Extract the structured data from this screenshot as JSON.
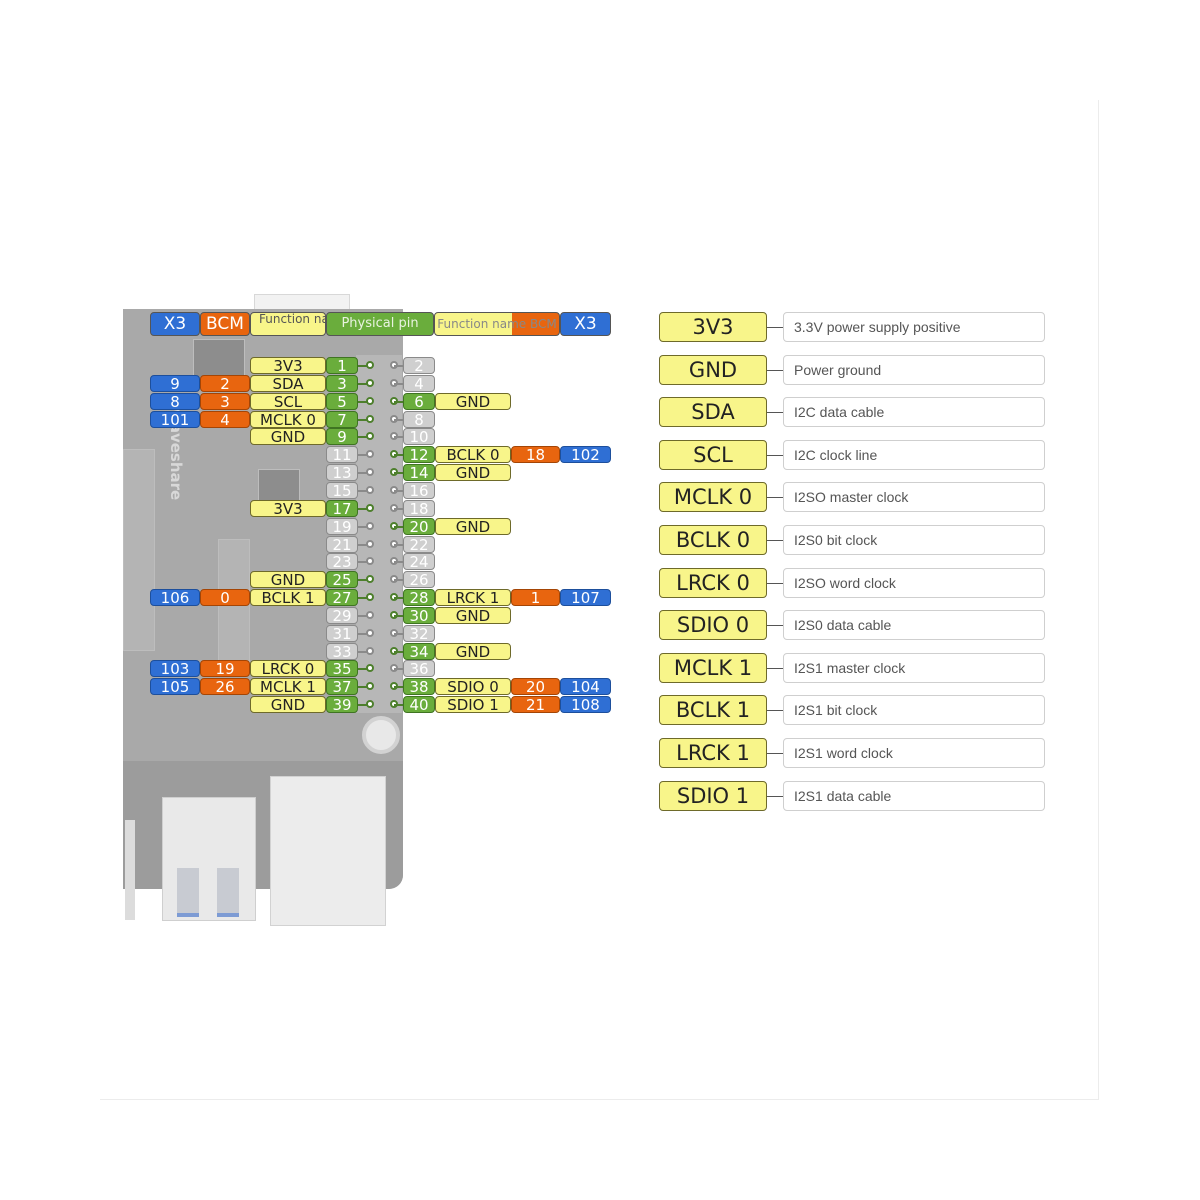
{
  "header": {
    "left": [
      "X3",
      "BCM",
      "Function name",
      "Physical pin"
    ],
    "right": [
      "Function name BCM",
      "X3"
    ]
  },
  "board": {
    "brand_text": "waveshare"
  },
  "colors": {
    "x3": "#2f6fd4",
    "bcm": "#e8650f",
    "function": "#f8f58a",
    "active_pin": "#6aad3c",
    "inactive_pin": "#cfcfcf"
  },
  "rows": [
    {
      "left": {
        "pin": "1",
        "fn": "3V3",
        "bcm": "",
        "x3": "",
        "active": true
      },
      "right": {
        "pin": "2",
        "fn": "",
        "bcm": "",
        "x3": "",
        "active": false
      }
    },
    {
      "left": {
        "pin": "3",
        "fn": "SDA",
        "bcm": "2",
        "x3": "9",
        "active": true
      },
      "right": {
        "pin": "4",
        "fn": "",
        "bcm": "",
        "x3": "",
        "active": false
      }
    },
    {
      "left": {
        "pin": "5",
        "fn": "SCL",
        "bcm": "3",
        "x3": "8",
        "active": true
      },
      "right": {
        "pin": "6",
        "fn": "GND",
        "bcm": "",
        "x3": "",
        "active": true
      }
    },
    {
      "left": {
        "pin": "7",
        "fn": "MCLK 0",
        "bcm": "4",
        "x3": "101",
        "active": true
      },
      "right": {
        "pin": "8",
        "fn": "",
        "bcm": "",
        "x3": "",
        "active": false
      }
    },
    {
      "left": {
        "pin": "9",
        "fn": "GND",
        "bcm": "",
        "x3": "",
        "active": true
      },
      "right": {
        "pin": "10",
        "fn": "",
        "bcm": "",
        "x3": "",
        "active": false
      }
    },
    {
      "left": {
        "pin": "11",
        "fn": "",
        "bcm": "",
        "x3": "",
        "active": false
      },
      "right": {
        "pin": "12",
        "fn": "BCLK 0",
        "bcm": "18",
        "x3": "102",
        "active": true
      }
    },
    {
      "left": {
        "pin": "13",
        "fn": "",
        "bcm": "",
        "x3": "",
        "active": false
      },
      "right": {
        "pin": "14",
        "fn": "GND",
        "bcm": "",
        "x3": "",
        "active": true
      }
    },
    {
      "left": {
        "pin": "15",
        "fn": "",
        "bcm": "",
        "x3": "",
        "active": false
      },
      "right": {
        "pin": "16",
        "fn": "",
        "bcm": "",
        "x3": "",
        "active": false
      }
    },
    {
      "left": {
        "pin": "17",
        "fn": "3V3",
        "bcm": "",
        "x3": "",
        "active": true
      },
      "right": {
        "pin": "18",
        "fn": "",
        "bcm": "",
        "x3": "",
        "active": false
      }
    },
    {
      "left": {
        "pin": "19",
        "fn": "",
        "bcm": "",
        "x3": "",
        "active": false
      },
      "right": {
        "pin": "20",
        "fn": "GND",
        "bcm": "",
        "x3": "",
        "active": true
      }
    },
    {
      "left": {
        "pin": "21",
        "fn": "",
        "bcm": "",
        "x3": "",
        "active": false
      },
      "right": {
        "pin": "22",
        "fn": "",
        "bcm": "",
        "x3": "",
        "active": false
      }
    },
    {
      "left": {
        "pin": "23",
        "fn": "",
        "bcm": "",
        "x3": "",
        "active": false
      },
      "right": {
        "pin": "24",
        "fn": "",
        "bcm": "",
        "x3": "",
        "active": false
      }
    },
    {
      "left": {
        "pin": "25",
        "fn": "GND",
        "bcm": "",
        "x3": "",
        "active": true
      },
      "right": {
        "pin": "26",
        "fn": "",
        "bcm": "",
        "x3": "",
        "active": false
      }
    },
    {
      "left": {
        "pin": "27",
        "fn": "BCLK 1",
        "bcm": "0",
        "x3": "106",
        "active": true
      },
      "right": {
        "pin": "28",
        "fn": "LRCK 1",
        "bcm": "1",
        "x3": "107",
        "active": true
      }
    },
    {
      "left": {
        "pin": "29",
        "fn": "",
        "bcm": "",
        "x3": "",
        "active": false
      },
      "right": {
        "pin": "30",
        "fn": "GND",
        "bcm": "",
        "x3": "",
        "active": true
      }
    },
    {
      "left": {
        "pin": "31",
        "fn": "",
        "bcm": "",
        "x3": "",
        "active": false
      },
      "right": {
        "pin": "32",
        "fn": "",
        "bcm": "",
        "x3": "",
        "active": false
      }
    },
    {
      "left": {
        "pin": "33",
        "fn": "",
        "bcm": "",
        "x3": "",
        "active": false
      },
      "right": {
        "pin": "34",
        "fn": "GND",
        "bcm": "",
        "x3": "",
        "active": true
      }
    },
    {
      "left": {
        "pin": "35",
        "fn": "LRCK 0",
        "bcm": "19",
        "x3": "103",
        "active": true
      },
      "right": {
        "pin": "36",
        "fn": "",
        "bcm": "",
        "x3": "",
        "active": false
      }
    },
    {
      "left": {
        "pin": "37",
        "fn": "MCLK 1",
        "bcm": "26",
        "x3": "105",
        "active": true
      },
      "right": {
        "pin": "38",
        "fn": "SDIO 0",
        "bcm": "20",
        "x3": "104",
        "active": true
      }
    },
    {
      "left": {
        "pin": "39",
        "fn": "GND",
        "bcm": "",
        "x3": "",
        "active": true
      },
      "right": {
        "pin": "40",
        "fn": "SDIO 1",
        "bcm": "21",
        "x3": "108",
        "active": true
      }
    }
  ],
  "legend": [
    {
      "key": "3V3",
      "desc": "3.3V power supply positive"
    },
    {
      "key": "GND",
      "desc": "Power ground"
    },
    {
      "key": "SDA",
      "desc": "I2C data cable"
    },
    {
      "key": "SCL",
      "desc": "I2C clock line"
    },
    {
      "key": "MCLK 0",
      "desc": "I2SO master clock"
    },
    {
      "key": "BCLK 0",
      "desc": "I2S0 bit clock"
    },
    {
      "key": "LRCK 0",
      "desc": "I2SO word clock"
    },
    {
      "key": "SDIO 0",
      "desc": "I2S0 data cable"
    },
    {
      "key": "MCLK 1",
      "desc": "I2S1 master clock"
    },
    {
      "key": "BCLK 1",
      "desc": "I2S1 bit clock"
    },
    {
      "key": "LRCK 1",
      "desc": "I2S1 word clock"
    },
    {
      "key": "SDIO 1",
      "desc": "I2S1 data cable"
    }
  ]
}
